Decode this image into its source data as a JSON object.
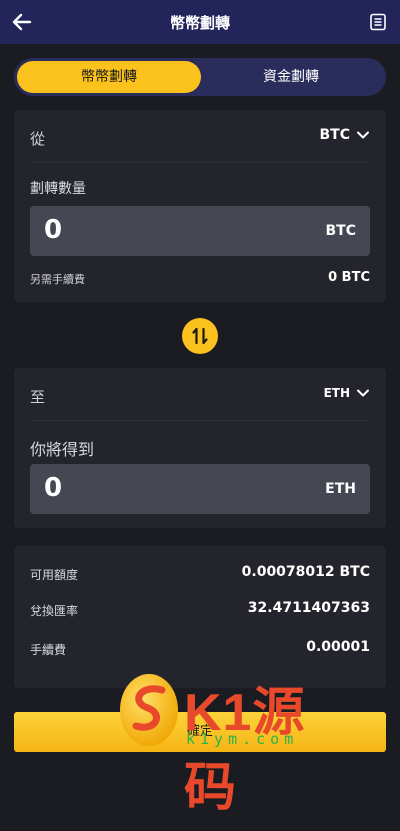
{
  "header": {
    "title": "幣幣劃轉"
  },
  "tabs": [
    {
      "label": "幣幣劃轉",
      "active": true
    },
    {
      "label": "資金劃轉",
      "active": false
    }
  ],
  "from": {
    "label": "從",
    "coin": "BTC",
    "amount_label": "劃轉數量",
    "amount_value": "0",
    "amount_unit": "BTC",
    "fee_label": "另需手續費",
    "fee_value": "0 BTC"
  },
  "to": {
    "label": "至",
    "coin": "ETH",
    "receive_label": "你將得到",
    "receive_value": "0",
    "receive_unit": "ETH"
  },
  "info": {
    "available_label": "可用額度",
    "available_value": "0.00078012 BTC",
    "rate_label": "兌換匯率",
    "rate_value": "32.4711407363",
    "fee_label": "手續費",
    "fee_value": "0.00001"
  },
  "confirm_label": "確定",
  "watermark": {
    "brand": "K1源码",
    "url": "k1ym.com"
  },
  "colors": {
    "accent": "#fbc21d",
    "header_bg": "#23245a",
    "card_bg": "#24252c",
    "page_bg": "#1b1c22"
  }
}
